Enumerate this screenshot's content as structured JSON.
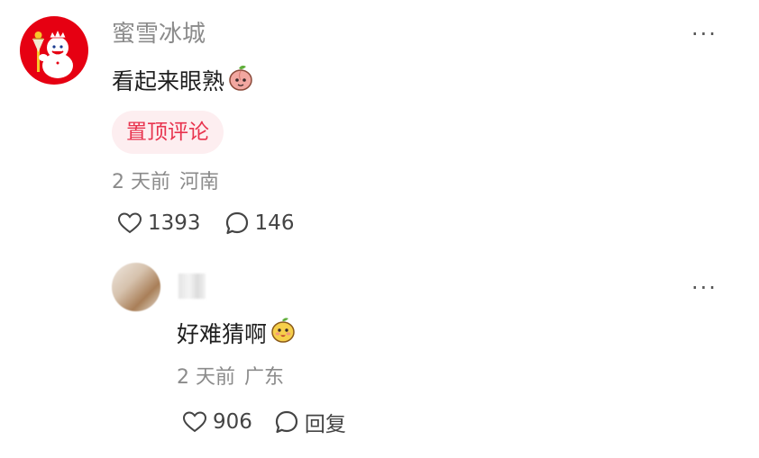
{
  "comment": {
    "username": "蜜雪冰城",
    "text": "看起来眼熟",
    "emoji_icon": "peach-emoji-icon",
    "pin_label": "置顶评论",
    "time": "2 天前",
    "location": "河南",
    "likes": "1393",
    "replies": "146",
    "more_label": "···"
  },
  "reply": {
    "text": "好难猜啊",
    "emoji_icon": "lemon-emoji-icon",
    "time": "2 天前",
    "location": "广东",
    "likes": "906",
    "reply_label": "回复",
    "more_label": "···"
  },
  "colors": {
    "brand_red": "#e60012",
    "pin_text": "#e8334e",
    "pin_bg": "#fdeef0",
    "meta_gray": "#8b8b8b"
  }
}
